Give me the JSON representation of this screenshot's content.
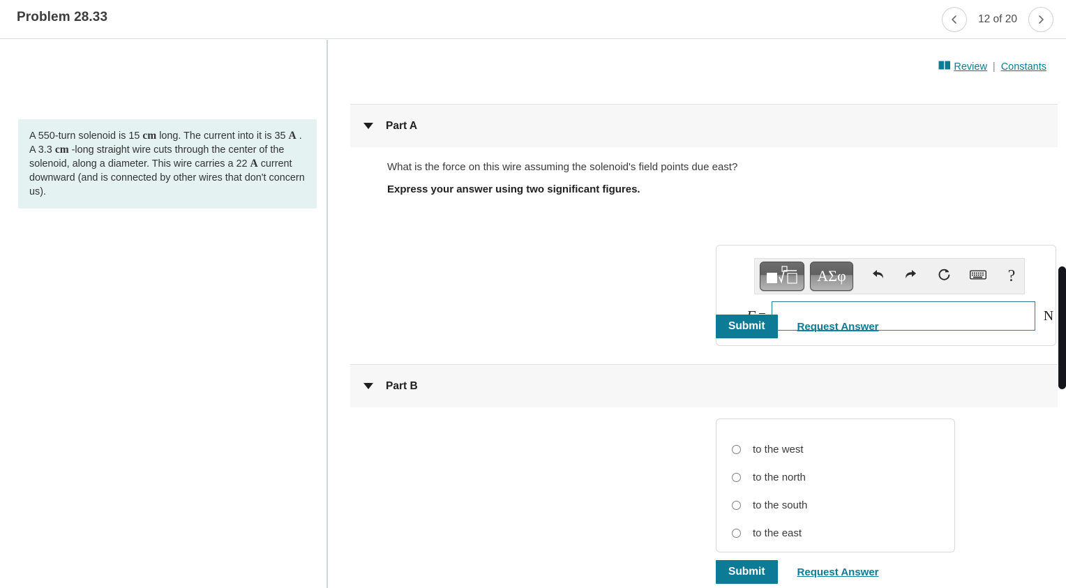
{
  "header": {
    "problem_title": "Problem 28.33",
    "pager_label": "12 of 20",
    "prev_icon": "chevron-left-icon",
    "next_icon": "chevron-right-icon"
  },
  "left_panel": {
    "problem_text_parts": {
      "p1": "A 550-turn solenoid is 15 ",
      "u1": "cm",
      "p2": " long. The current into it is 35 ",
      "u2": "A",
      "p3": " . A 3.3 ",
      "u3": "cm",
      "p4": " -long straight wire cuts through the center of the solenoid, along a diameter. This wire carries a 22 ",
      "u4": "A",
      "p5": " current downward (and is connected by other wires that don't concern us)."
    }
  },
  "right_panel": {
    "review_link": "Review",
    "separator": "|",
    "constants_link": "Constants",
    "book_icon": "open-book-icon",
    "part_a": {
      "label": "Part A",
      "question": "What is the force on this wire assuming the solenoid's field points due east?",
      "instruction": "Express your answer using two significant figures.",
      "answer": {
        "variable": "F",
        "equals": "=",
        "value": "",
        "placeholder": "",
        "unit": "N"
      },
      "toolbar": {
        "math_template_label": "math-template",
        "greek_label": "ΑΣφ",
        "undo_label": "undo",
        "redo_label": "redo",
        "reset_label": "reset",
        "keyboard_label": "keyboard",
        "help_label": "?"
      },
      "submit_label": "Submit",
      "request_answer_label": "Request Answer"
    },
    "part_b": {
      "label": "Part B",
      "options": [
        {
          "label": "to the west",
          "selected": false
        },
        {
          "label": "to the north",
          "selected": false
        },
        {
          "label": "to the south",
          "selected": false
        },
        {
          "label": "to the east",
          "selected": false
        }
      ],
      "submit_label": "Submit",
      "request_answer_label": "Request Answer"
    }
  },
  "colors": {
    "accent_teal": "#0d7b95",
    "problem_bg": "#e4f2f2",
    "panel_header_bg": "#f7f7f7",
    "input_border": "#2a7f96",
    "scrollbar_thumb": "#15161d"
  }
}
